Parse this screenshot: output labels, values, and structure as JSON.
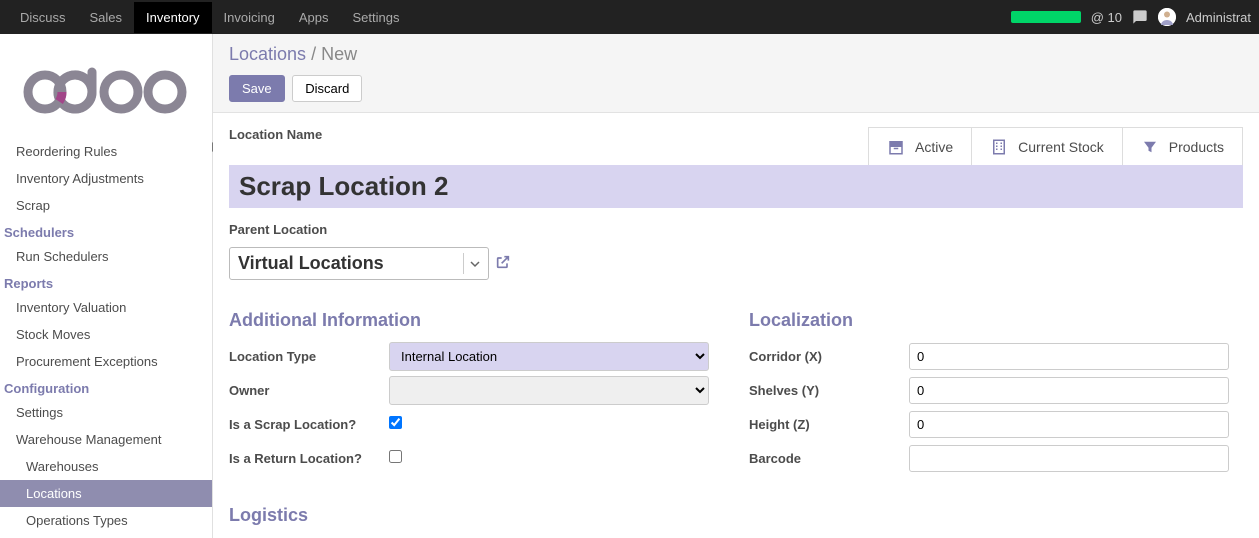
{
  "topnav": {
    "items": [
      "Discuss",
      "Sales",
      "Inventory",
      "Invoicing",
      "Apps",
      "Settings"
    ],
    "active": "Inventory",
    "messages": "@ 10",
    "user": "Administrat"
  },
  "sidebar": {
    "items1": [
      "Reordering Rules",
      "Inventory Adjustments",
      "Scrap"
    ],
    "sec_schedulers": "Schedulers",
    "schedulers": [
      "Run Schedulers"
    ],
    "sec_reports": "Reports",
    "reports": [
      "Inventory Valuation",
      "Stock Moves",
      "Procurement Exceptions"
    ],
    "sec_config": "Configuration",
    "config": [
      "Settings"
    ],
    "wm_label": "Warehouse Management",
    "wm": [
      "Warehouses",
      "Locations",
      "Operations Types"
    ],
    "active": "Locations"
  },
  "breadcrumb": {
    "root": "Locations",
    "current": "New"
  },
  "buttons": {
    "save": "Save",
    "discard": "Discard"
  },
  "stat": {
    "active": "Active",
    "stock": "Current Stock",
    "products": "Products"
  },
  "form": {
    "location_name_label": "Location Name",
    "location_name_value": "Scrap Location 2",
    "parent_location_label": "Parent Location",
    "parent_location_value": "Virtual Locations",
    "sec_additional": "Additional Information",
    "location_type_label": "Location Type",
    "location_type_value": "Internal Location",
    "owner_label": "Owner",
    "owner_value": "",
    "scrap_label": "Is a Scrap Location?",
    "scrap_checked": true,
    "return_label": "Is a Return Location?",
    "return_checked": false,
    "sec_localization": "Localization",
    "corridor_label": "Corridor (X)",
    "corridor_value": "0",
    "shelves_label": "Shelves (Y)",
    "shelves_value": "0",
    "height_label": "Height (Z)",
    "height_value": "0",
    "barcode_label": "Barcode",
    "barcode_value": "",
    "sec_logistics": "Logistics"
  }
}
